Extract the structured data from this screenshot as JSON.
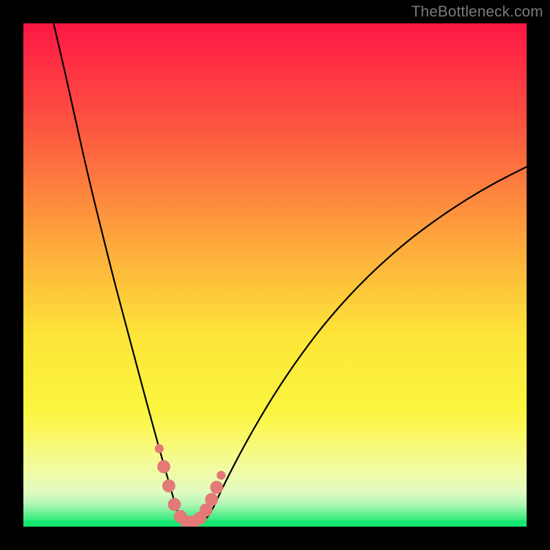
{
  "watermark": "TheBottleneck.com",
  "colors": {
    "background": "#000000",
    "gradient_top": "#fe1745",
    "gradient_mid_upper": "#fd8a3d",
    "gradient_mid": "#fdea3a",
    "gradient_lower": "#f6fb60",
    "gradient_light": "#eefcaa",
    "gradient_green_a": "#8af59e",
    "gradient_green_b": "#35ec7f",
    "gradient_bottom": "#16e770",
    "curve": "#000000",
    "marker_fill": "#e37a77",
    "marker_stroke": "#e37a77"
  },
  "chart_data": {
    "type": "line",
    "title": "",
    "xlabel": "",
    "ylabel": "",
    "xlim": [
      0,
      100
    ],
    "ylim": [
      0,
      100
    ],
    "series": [
      {
        "name": "bottleneck-curve",
        "x": [
          6,
          8,
          10,
          12,
          14,
          16,
          18,
          20,
          22,
          24,
          25,
          26,
          27,
          28,
          29,
          30,
          30.7,
          31.5,
          33,
          35,
          36,
          37,
          38,
          39,
          41,
          44,
          48,
          52,
          56,
          60,
          65,
          70,
          76,
          82,
          88,
          94,
          100
        ],
        "y": [
          100,
          91.5,
          82.5,
          73.5,
          65,
          57,
          49,
          41.5,
          34,
          26.5,
          22.8,
          19.2,
          15.5,
          12,
          8.5,
          5,
          2.7,
          1.4,
          0.8,
          0.8,
          1.3,
          2.4,
          4.3,
          6.5,
          10.6,
          16.3,
          23.3,
          29.6,
          35.3,
          40.5,
          46.2,
          51.2,
          56.5,
          61,
          65,
          68.5,
          71.5
        ]
      }
    ],
    "markers": {
      "name": "highlight-segment",
      "x": [
        27.0,
        27.9,
        28.9,
        30.0,
        31.2,
        32.5,
        33.8,
        35.1,
        36.3,
        37.4,
        38.4,
        39.3
      ],
      "y": [
        15.5,
        11.9,
        8.1,
        4.4,
        2.0,
        0.9,
        0.9,
        1.7,
        3.3,
        5.4,
        7.8,
        10.2
      ],
      "radius_end": 6.5,
      "radius_mid": 9.5
    },
    "gradient_note": "vertical: top red -> orange -> yellow -> pale -> green bottom strip"
  }
}
